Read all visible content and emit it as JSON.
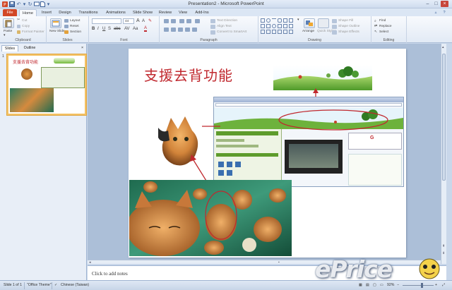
{
  "window": {
    "title": "Presentation2 - Microsoft PowerPoint"
  },
  "tabs": [
    "File",
    "Home",
    "Insert",
    "Design",
    "Transitions",
    "Animations",
    "Slide Show",
    "Review",
    "View",
    "Add-Ins"
  ],
  "ribbon": {
    "clipboard": {
      "label": "Clipboard",
      "paste": "Paste",
      "cut": "Cut",
      "copy": "Copy",
      "format_painter": "Format Painter"
    },
    "slides": {
      "label": "Slides",
      "new_slide": "New Slide",
      "layout": "Layout",
      "reset": "Reset",
      "section": "Section"
    },
    "font": {
      "label": "Font",
      "size": "44"
    },
    "paragraph": {
      "label": "Paragraph",
      "text_direction": "Text Direction",
      "align_text": "Align Text",
      "convert_smartart": "Convert to SmartArt"
    },
    "drawing": {
      "label": "Drawing",
      "arrange": "Arrange",
      "quick_styles": "Quick Styles",
      "shape_fill": "Shape Fill",
      "shape_outline": "Shape Outline",
      "shape_effects": "Shape Effects"
    },
    "editing": {
      "label": "Editing",
      "find": "Find",
      "replace": "Replace",
      "select": "Select"
    }
  },
  "left_pane": {
    "tabs": [
      "Slides",
      "Outline"
    ],
    "slide_number": "1",
    "thumb_title": "支援去背功能"
  },
  "slide": {
    "title": "支援去背功能"
  },
  "notes": {
    "placeholder": "Click to add notes"
  },
  "status": {
    "slide_info": "Slide 1 of 1",
    "theme": "\"Office Theme\"",
    "language": "Chinese (Taiwan)",
    "zoom": "92%"
  },
  "watermark": "ePrice",
  "colors": {
    "title_red": "#c0282e",
    "file_tab": "#d24726",
    "accent_blue": "#3a5f98"
  }
}
